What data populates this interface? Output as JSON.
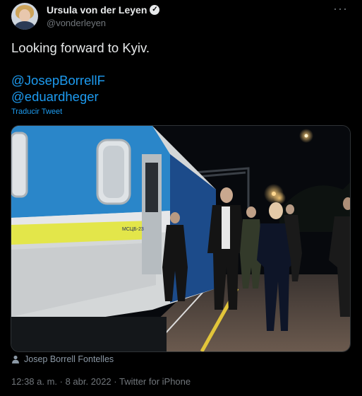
{
  "user": {
    "display_name": "Ursula von der Leyen",
    "handle": "@vonderleyen",
    "verified": true,
    "avatar_icon": "profile-photo"
  },
  "more_label": "···",
  "tweet": {
    "text": "Looking forward to Kyiv.",
    "mentions": [
      "@JosepBorrellF",
      "@eduardheger"
    ],
    "translate_label": "Traducir Tweet"
  },
  "media": {
    "train_label": "МСЦБ-23"
  },
  "photo_credit": "Josep Borrell Fontelles",
  "meta": "12:38 a. m. · 8 abr. 2022 · Twitter for iPhone",
  "colors": {
    "background": "#000000",
    "link": "#1d9bf0",
    "text": "#e7e9ea",
    "muted": "#71767b"
  }
}
